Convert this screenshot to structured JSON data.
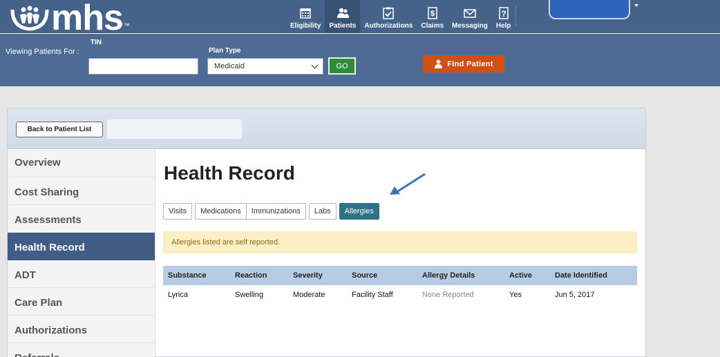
{
  "header": {
    "logo_text": "mhs",
    "logo_tm": "™",
    "nav": [
      {
        "label": "Eligibility",
        "icon": "calendar-icon"
      },
      {
        "label": "Patients",
        "icon": "patients-icon"
      },
      {
        "label": "Authorizations",
        "icon": "checklist-icon"
      },
      {
        "label": "Claims",
        "icon": "dollar-document-icon"
      },
      {
        "label": "Messaging",
        "icon": "envelope-icon"
      },
      {
        "label": "Help",
        "icon": "question-icon"
      }
    ],
    "active_nav": "Patients"
  },
  "filter": {
    "viewing_label": "Viewing Patients For :",
    "tin_label": "TIN",
    "tin_value": "",
    "plan_type_label": "Plan Type",
    "plan_type_value": "Medicaid",
    "go_label": "GO",
    "find_patient_label": "Find Patient"
  },
  "panel": {
    "back_button": "Back to Patient List",
    "sidebar": [
      "Overview",
      "Cost Sharing",
      "Assessments",
      "Health Record",
      "ADT",
      "Care Plan",
      "Authorizations",
      "Referrals"
    ],
    "active_sidebar": "Health Record"
  },
  "content": {
    "title": "Health Record",
    "tabs": [
      "Visits",
      "Medications",
      "Immunizations",
      "Labs",
      "Allergies"
    ],
    "active_tab": "Allergies",
    "notice": "Allergies listed are self reported.",
    "table": {
      "headers": [
        "Substance",
        "Reaction",
        "Severity",
        "Source",
        "Allergy Details",
        "Active",
        "Date Identified"
      ],
      "rows": [
        [
          "Lyrica",
          "Swelling",
          "Moderate",
          "Facility Staff",
          "None Reported",
          "Yes",
          "Jun 5, 2017"
        ]
      ]
    }
  },
  "colors": {
    "header_bg": "#45628a",
    "filter_bg": "#4e6b95",
    "active_sidebar": "#415d86",
    "active_tab": "#2e7287",
    "go_button": "#2e8b3a",
    "find_button": "#d14e17",
    "notice_bg": "#fbefc6",
    "table_header": "#b7cbe3",
    "arrow": "#3f72b8"
  }
}
